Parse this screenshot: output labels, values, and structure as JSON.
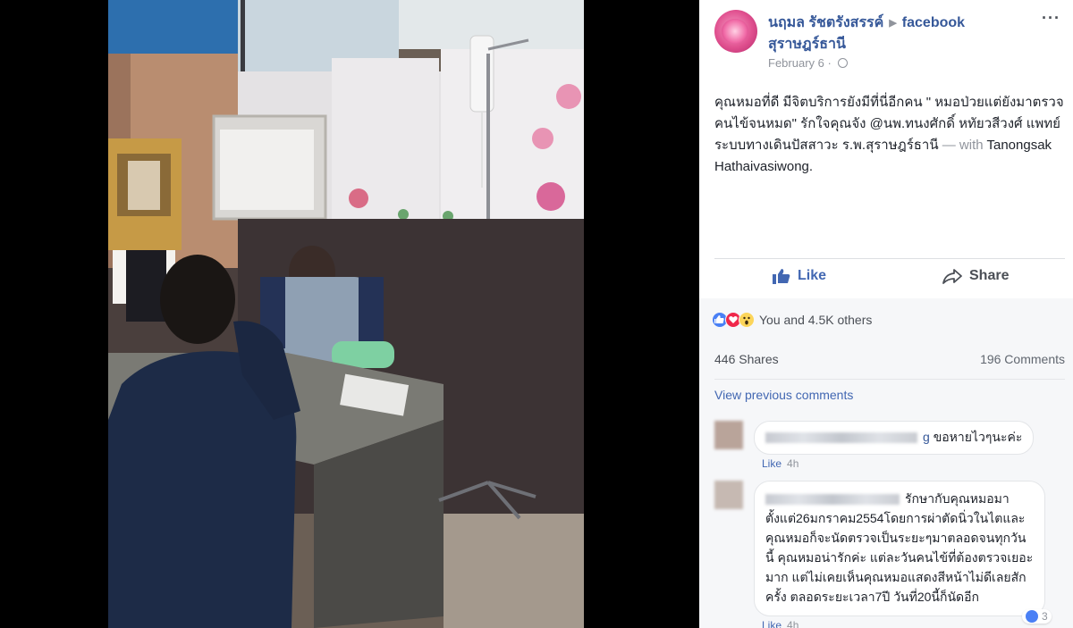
{
  "post": {
    "author": "นฤมล รัชตรังสรรค์",
    "page": "facebook",
    "page_line2": "สุราษฎร์ธานี",
    "date": "February 6",
    "more": "···",
    "text_main": "คุณหมอที่ดี มีจิตบริการยังมีที่นี่อีกคน \" หมอป่วยแต่ยังมาตรวจคนไข้จนหมด\" รักใจคุณจัง @นพ.ทนงศักดิ์ หทัยวสีวงศ์ แพทย์ระบบทางเดินปัสสาวะ ร.พ.สุราษฎร์ธานี",
    "text_with": " — with ",
    "text_tag": "Tanongsak Hathaivasiwong",
    "text_end": "."
  },
  "actions": {
    "like_label": "Like",
    "share_label": "Share"
  },
  "reactions": {
    "summary": "You and 4.5K others",
    "icons": [
      "like-icon",
      "love-icon",
      "wow-icon"
    ],
    "colors": {
      "like": "#4a80f5",
      "love": "#f0284a",
      "wow": "#fcd55a"
    }
  },
  "stats": {
    "shares": "446 Shares",
    "comments": "196 Comments"
  },
  "view_previous": "View previous comments",
  "comments": [
    {
      "name_suffix": "g",
      "text": "ขอหายไวๆนะค่ะ",
      "like": "Like",
      "time": "4h"
    },
    {
      "text": "รักษากับคุณหมอมาตั้งแต่26มกราคม2554โดยการผ่าตัดนิ่วในไตและคุณหมอก็จะนัดตรวจเป็นระยะๆมาตลอดจนทุกวันนี้ คุณหมอน่ารักค่ะ แต่ละวันคนไข้ที่ต้องตรวจเยอะมาก แต่ไม่เคยเห็นคุณหมอแสดงสีหน้าไม่ดีเลยสักครั้ง ตลอดระยะเวลา7ปี วันที่20นี้ก็นัดอีก",
      "like": "Like",
      "time": "4h",
      "reaction_count": "3"
    }
  ],
  "colors": {
    "link": "#365899",
    "accent": "#4267b2",
    "muted": "#90949c"
  }
}
